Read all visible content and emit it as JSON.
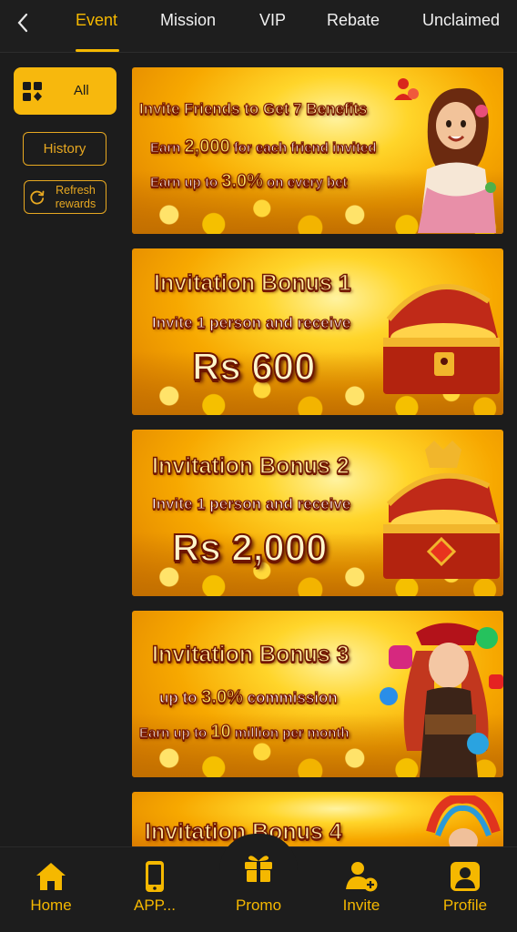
{
  "topnav": {
    "tabs": [
      {
        "label": "Event",
        "active": true
      },
      {
        "label": "Mission",
        "active": false
      },
      {
        "label": "VIP",
        "active": false
      },
      {
        "label": "Rebate",
        "active": false
      },
      {
        "label": "Unclaimed",
        "active": false
      }
    ],
    "back_icon": "chevron-left-icon"
  },
  "sidebar": {
    "all_label": "All",
    "all_icon": "category-grid-icon",
    "history_label": "History",
    "refresh_label": "Refresh rewards",
    "refresh_icon": "refresh-icon"
  },
  "banners": [
    {
      "title": "Invite Friends to Get 7 Benefits",
      "line1_pre": "Earn",
      "line1_value": "2,000",
      "line1_post": "for each friend invited",
      "line2_pre": "Earn up to",
      "line2_value": "3.0%",
      "line2_post": "on every bet"
    },
    {
      "title": "Invitation Bonus 1",
      "subtitle": "Invite 1 person and receive",
      "amount": "Rs 600"
    },
    {
      "title": "Invitation Bonus 2",
      "subtitle": "Invite 1 person and receive",
      "amount": "Rs 2,000"
    },
    {
      "title": "Invitation Bonus 3",
      "line1_pre": "up to",
      "line1_value": "3.0%",
      "line1_post": "commission",
      "line2_pre": "Earn up to",
      "line2_value": "10",
      "line2_post": "million per month"
    },
    {
      "title": "Invitation Bonus 4"
    }
  ],
  "bottomnav": {
    "items": [
      {
        "label": "Home",
        "icon": "home-icon"
      },
      {
        "label": "APP...",
        "icon": "smartphone-icon"
      },
      {
        "label": "Promo",
        "icon": "gift-icon"
      },
      {
        "label": "Invite",
        "icon": "add-user-icon"
      },
      {
        "label": "Profile",
        "icon": "profile-icon"
      }
    ]
  },
  "colors": {
    "accent": "#f5b800",
    "background": "#1c1c1c",
    "banner_gold": "#f7a800"
  }
}
